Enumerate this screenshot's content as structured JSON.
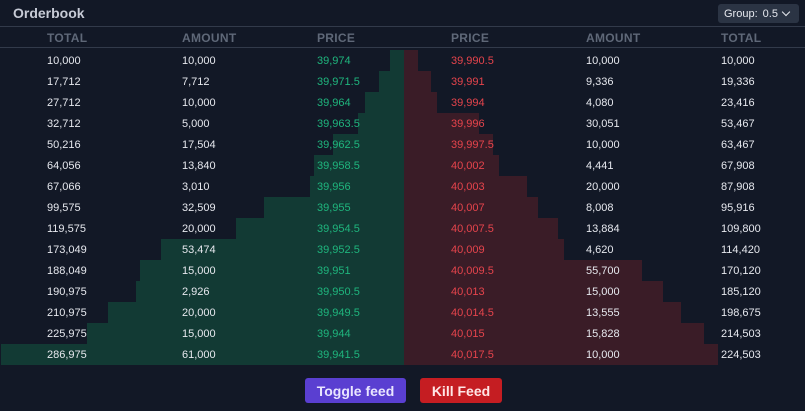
{
  "header": {
    "title": "Orderbook",
    "group_label": "Group:",
    "group_value": "0.5"
  },
  "columns": {
    "bids": [
      "TOTAL",
      "AMOUNT",
      "PRICE"
    ],
    "asks": [
      "PRICE",
      "AMOUNT",
      "TOTAL"
    ]
  },
  "bids": [
    {
      "total": "10,000",
      "amount": "10,000",
      "price": "39,974",
      "depth": 0.035
    },
    {
      "total": "17,712",
      "amount": "7,712",
      "price": "39,971.5",
      "depth": 0.062
    },
    {
      "total": "27,712",
      "amount": "10,000",
      "price": "39,964",
      "depth": 0.097
    },
    {
      "total": "32,712",
      "amount": "5,000",
      "price": "39,963.5",
      "depth": 0.114
    },
    {
      "total": "50,216",
      "amount": "17,504",
      "price": "39,962.5",
      "depth": 0.175
    },
    {
      "total": "64,056",
      "amount": "13,840",
      "price": "39,958.5",
      "depth": 0.223
    },
    {
      "total": "67,066",
      "amount": "3,010",
      "price": "39,956",
      "depth": 0.234
    },
    {
      "total": "99,575",
      "amount": "32,509",
      "price": "39,955",
      "depth": 0.347
    },
    {
      "total": "119,575",
      "amount": "20,000",
      "price": "39,954.5",
      "depth": 0.417
    },
    {
      "total": "173,049",
      "amount": "53,474",
      "price": "39,952.5",
      "depth": 0.603
    },
    {
      "total": "188,049",
      "amount": "15,000",
      "price": "39,951",
      "depth": 0.655
    },
    {
      "total": "190,975",
      "amount": "2,926",
      "price": "39,950.5",
      "depth": 0.665
    },
    {
      "total": "210,975",
      "amount": "20,000",
      "price": "39,949.5",
      "depth": 0.735
    },
    {
      "total": "225,975",
      "amount": "15,000",
      "price": "39,944",
      "depth": 0.787
    },
    {
      "total": "286,975",
      "amount": "61,000",
      "price": "39,941.5",
      "depth": 1.0
    }
  ],
  "asks": [
    {
      "price": "39,990.5",
      "amount": "10,000",
      "total": "10,000",
      "depth": 0.035
    },
    {
      "price": "39,991",
      "amount": "9,336",
      "total": "19,336",
      "depth": 0.067
    },
    {
      "price": "39,994",
      "amount": "4,080",
      "total": "23,416",
      "depth": 0.082
    },
    {
      "price": "39,996",
      "amount": "30,051",
      "total": "53,467",
      "depth": 0.186
    },
    {
      "price": "39,997.5",
      "amount": "10,000",
      "total": "63,467",
      "depth": 0.221
    },
    {
      "price": "40,002",
      "amount": "4,441",
      "total": "67,908",
      "depth": 0.237
    },
    {
      "price": "40,003",
      "amount": "20,000",
      "total": "87,908",
      "depth": 0.306
    },
    {
      "price": "40,007",
      "amount": "8,008",
      "total": "95,916",
      "depth": 0.334
    },
    {
      "price": "40,007.5",
      "amount": "13,884",
      "total": "109,800",
      "depth": 0.383
    },
    {
      "price": "40,009",
      "amount": "4,620",
      "total": "114,420",
      "depth": 0.399
    },
    {
      "price": "40,009.5",
      "amount": "55,700",
      "total": "170,120",
      "depth": 0.593
    },
    {
      "price": "40,013",
      "amount": "15,000",
      "total": "185,120",
      "depth": 0.645
    },
    {
      "price": "40,014.5",
      "amount": "13,555",
      "total": "198,675",
      "depth": 0.692
    },
    {
      "price": "40,015",
      "amount": "15,828",
      "total": "214,503",
      "depth": 0.747
    },
    {
      "price": "40,017.5",
      "amount": "10,000",
      "total": "224,503",
      "depth": 0.782
    }
  ],
  "buttons": {
    "toggle": "Toggle feed",
    "kill": "Kill Feed"
  },
  "colors": {
    "bid_price": "#1fb57d",
    "ask_price": "#e6444c",
    "bid_depth": "#123a34",
    "ask_depth": "#3a1c27",
    "toggle_button": "#5a3fd1",
    "kill_button": "#c51d22"
  }
}
